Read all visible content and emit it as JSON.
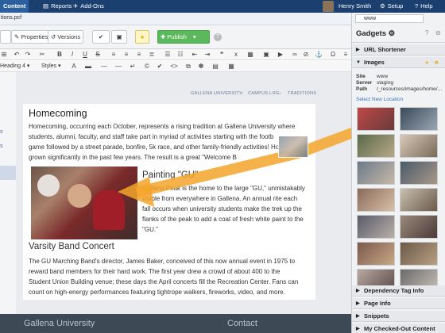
{
  "topnav": {
    "items": [
      {
        "label": "Content"
      },
      {
        "label": "Reports"
      },
      {
        "label": "Add-Ons"
      }
    ],
    "user": "Henry Smith",
    "setup": "Setup",
    "help": "Help",
    "site": "www"
  },
  "file": {
    "name": "tions.pcf"
  },
  "toolbar": {
    "properties": "Properties",
    "versions": "Versions",
    "publish": "Publish"
  },
  "editor": {
    "format": "Heading 4",
    "styles": "Styles"
  },
  "breadcrumb": [
    "GALLENA UNIVERSITY",
    "CAMPUS LIFE",
    "TRADITIONS"
  ],
  "page": {
    "title": "Homecoming",
    "intro_lines": [
      "Homecoming, occurring each October, represents a rising tradition at Gallena University where",
      "students, alumni, faculty, and staff take part in myriad of activities starting with the footb",
      "game followed by a street parade, bonfire, 5k race, and other family-friendly activities! Ho",
      "grown significantly in the past few years. The result is a great \"Welcome B"
    ],
    "section2_title": "Painting \"GU\"",
    "section2_lines": [
      "Gallena Peak is the home to the large \"GU,\" unmistakably",
      "visible from everywhere in Gallena. An annual rite each",
      "fall occurs when university students make the trek up the",
      "flanks of the peak to add a coat of fresh white paint to the",
      "\"GU.\""
    ],
    "section3_title": "Varsity Band Concert",
    "section3_lines": [
      "The GU Marching Band's director, James Baker, conceived of this now annual event in 1975 to",
      "reward band members for their hard work. The first year drew a crowd of about 400 to the",
      "Student Union Building venue; these days the April concerts fill the Recreation Center. Fans can",
      "count on high-energy performances featuring tightrope walkers, fireworks, video, and more."
    ],
    "footer_left": "Gallena University",
    "footer_right": "Contact"
  },
  "gadgets": {
    "title": "Gadgets",
    "url_shortener": "URL Shortener",
    "images": "Images",
    "site_label": "Site",
    "site_value": "www",
    "server_label": "Server",
    "server_value": "staging",
    "path_label": "Path",
    "path_value": "/_resources/images/home/...",
    "select_location": "Select New Location",
    "dependency": "Dependency Tag Info",
    "page_info": "Page Info",
    "snippets": "Snippets",
    "checked_out": "My Checked-Out Content"
  },
  "colors": {
    "nav": "#1b3f6f",
    "publish": "#5cb85c",
    "drag_arrow": "#f4a52a",
    "link": "#3a78c2"
  },
  "icons": [
    "logo-icon",
    "reports-icon",
    "addons-icon",
    "gear-icon",
    "help-icon",
    "save-icon",
    "check-icon",
    "camera-icon",
    "bulb-icon",
    "star-icon",
    "folder-icon"
  ]
}
